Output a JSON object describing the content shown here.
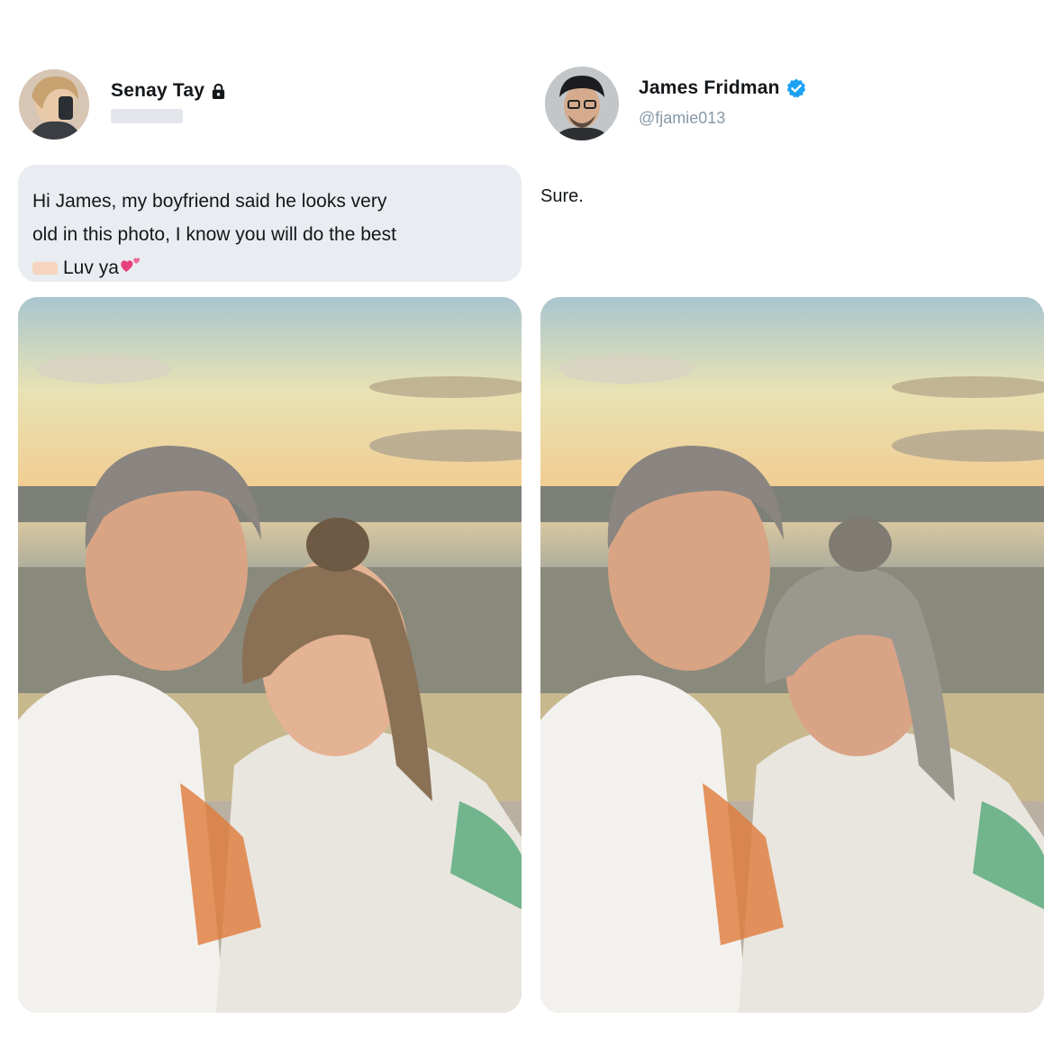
{
  "left_post": {
    "author_name": "Senay Tay",
    "author_icon": "lock-icon",
    "message_line1": "Hi James, my boyfriend said he looks very",
    "message_line2": "old in this photo, I know you will do the best",
    "message_line3": "Luv ya",
    "photo_icon": "couple-selfie-original"
  },
  "right_post": {
    "author_name": "James Fridman",
    "author_icon": "verified-badge-icon",
    "handle": "@fjamie013",
    "reply": "Sure.",
    "photo_icon": "couple-selfie-edited"
  },
  "colors": {
    "verified_blue": "#1da1f2",
    "bubble_bg": "#e9ecf0",
    "handle_gray": "#8899a6",
    "heart_pink": "#e8407a"
  }
}
